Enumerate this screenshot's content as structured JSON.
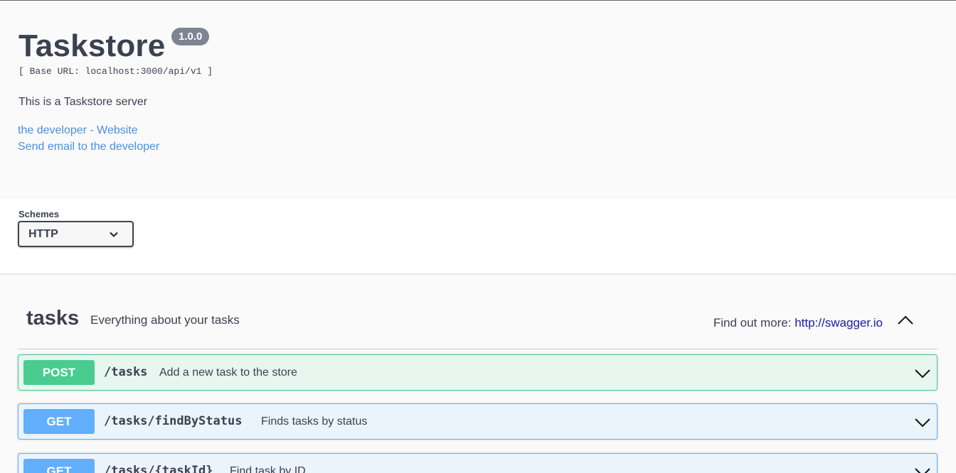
{
  "info": {
    "title": "Taskstore",
    "version": "1.0.0",
    "base_url": "[ Base URL: localhost:3000/api/v1 ]",
    "description": "This is a Taskstore server",
    "links": [
      "the developer - Website",
      "Send email to the developer"
    ]
  },
  "schemes": {
    "label": "Schemes",
    "selected": "HTTP"
  },
  "tag": {
    "name": "tasks",
    "description": "Everything about your tasks",
    "more_label": "Find out more: ",
    "more_link": "http://swagger.io"
  },
  "operations": [
    {
      "method": "POST",
      "path": "/tasks",
      "summary": "Add a new task to the store"
    },
    {
      "method": "GET",
      "path": "/tasks/findByStatus",
      "summary": "Finds tasks by status"
    },
    {
      "method": "GET",
      "path": "/tasks/{taskId}",
      "summary": "Find task by ID"
    }
  ],
  "colors": {
    "post": "#49cc90",
    "get": "#61affe",
    "text": "#3b4151",
    "link": "#4990e2"
  },
  "icons": [
    "chevron-down-icon",
    "chevron-up-icon"
  ]
}
